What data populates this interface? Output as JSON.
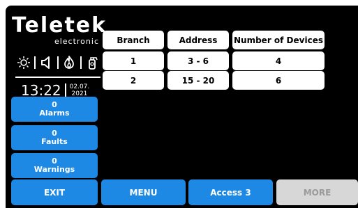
{
  "brand": {
    "logo": "Teletek",
    "subtitle": "electronic"
  },
  "status_icons": [
    "sun-icon",
    "speaker-icon",
    "flame-icon",
    "fire-extinguisher-icon"
  ],
  "clock": {
    "time": "13:22",
    "date_day_month": "02.07.",
    "date_year": "2021"
  },
  "counters": [
    {
      "count": "0",
      "label": "Alarms"
    },
    {
      "count": "0",
      "label": "Faults"
    },
    {
      "count": "0",
      "label": "Warnings"
    }
  ],
  "table": {
    "headers": [
      "Branch",
      "Address",
      "Number of Devices"
    ],
    "rows": [
      [
        "1",
        "3 - 6",
        "4"
      ],
      [
        "2",
        "15 - 20",
        "6"
      ]
    ]
  },
  "bottom_bar": {
    "exit": "EXIT",
    "menu": "MENU",
    "access": "Access 3",
    "more": "MORE"
  },
  "colors": {
    "accent": "#1e88e5",
    "screen_bg": "#000000",
    "disabled": "#d7d7d7"
  }
}
